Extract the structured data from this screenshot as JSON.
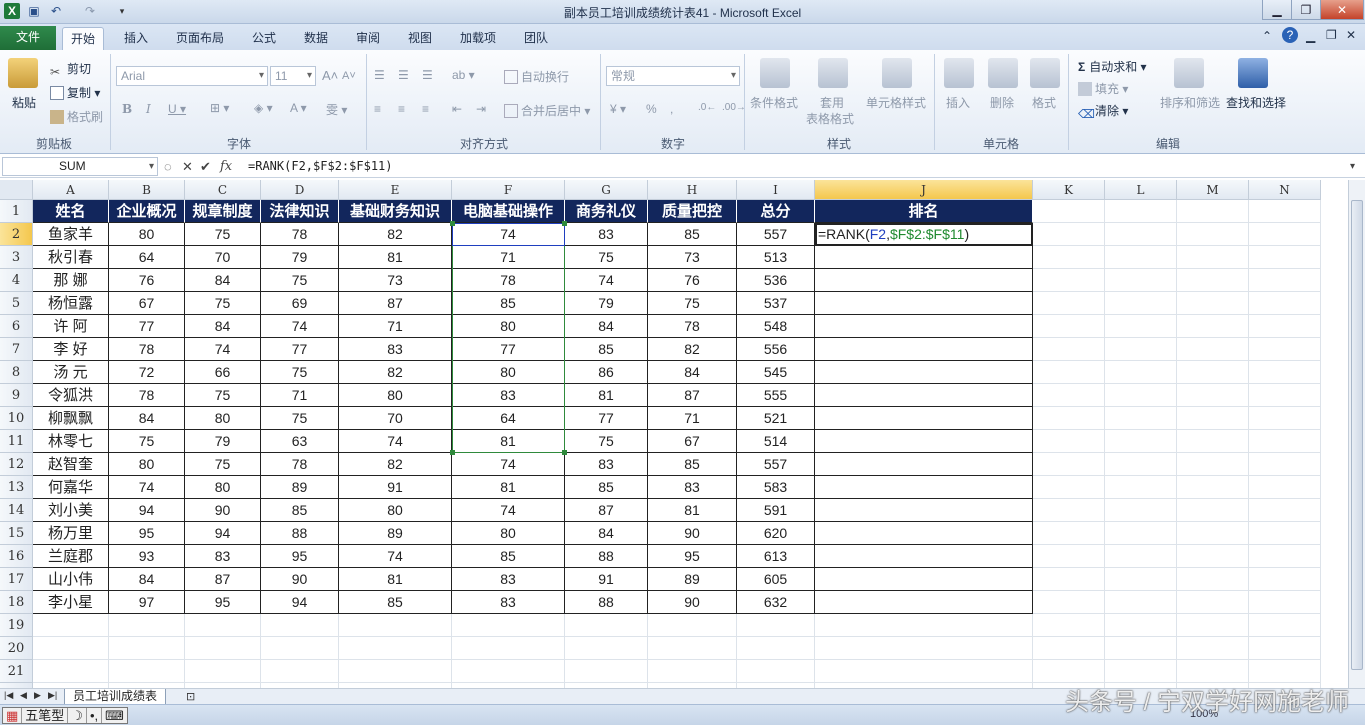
{
  "window": {
    "title": "副本员工培训成绩统计表41 - Microsoft Excel"
  },
  "tabs": [
    "文件",
    "开始",
    "插入",
    "页面布局",
    "公式",
    "数据",
    "审阅",
    "视图",
    "加载项",
    "团队"
  ],
  "ribbon": {
    "clipboard": {
      "paste": "粘贴",
      "cut": "剪切",
      "copy": "复制",
      "format_painter": "格式刷",
      "label": "剪贴板"
    },
    "font": {
      "name": "Arial",
      "size": "11",
      "label": "字体"
    },
    "alignment": {
      "wrap": "自动换行",
      "merge": "合并后居中",
      "label": "对齐方式"
    },
    "number": {
      "format": "常规",
      "label": "数字"
    },
    "styles": {
      "cond": "条件格式",
      "table_a": "套用",
      "table_b": "表格格式",
      "cell_styles": "单元格样式",
      "label": "样式"
    },
    "cells": {
      "insert": "插入",
      "delete": "删除",
      "format": "格式",
      "label": "单元格"
    },
    "editing": {
      "autosum": "自动求和",
      "fill": "填充",
      "clear": "清除",
      "sort": "排序和筛选",
      "find": "查找和选择",
      "label": "编辑"
    }
  },
  "formula_bar": {
    "name_box": "SUM",
    "formula": "=RANK(F2,$F$2:$F$11)"
  },
  "columns": [
    "A",
    "B",
    "C",
    "D",
    "E",
    "F",
    "G",
    "H",
    "I",
    "J",
    "K",
    "L",
    "M",
    "N"
  ],
  "headers": [
    "姓名",
    "企业概况",
    "规章制度",
    "法律知识",
    "基础财务知识",
    "电脑基础操作",
    "商务礼仪",
    "质量把控",
    "总分",
    "排名"
  ],
  "rows": [
    [
      "鱼家羊",
      "80",
      "75",
      "78",
      "82",
      "74",
      "83",
      "85",
      "557"
    ],
    [
      "秋引春",
      "64",
      "70",
      "79",
      "81",
      "71",
      "75",
      "73",
      "513"
    ],
    [
      "那  娜",
      "76",
      "84",
      "75",
      "73",
      "78",
      "74",
      "76",
      "536"
    ],
    [
      "杨恒露",
      "67",
      "75",
      "69",
      "87",
      "85",
      "79",
      "75",
      "537"
    ],
    [
      "许  阿",
      "77",
      "84",
      "74",
      "71",
      "80",
      "84",
      "78",
      "548"
    ],
    [
      "李  好",
      "78",
      "74",
      "77",
      "83",
      "77",
      "85",
      "82",
      "556"
    ],
    [
      "汤  元",
      "72",
      "66",
      "75",
      "82",
      "80",
      "86",
      "84",
      "545"
    ],
    [
      "令狐洪",
      "78",
      "75",
      "71",
      "80",
      "83",
      "81",
      "87",
      "555"
    ],
    [
      "柳飘飘",
      "84",
      "80",
      "75",
      "70",
      "64",
      "77",
      "71",
      "521"
    ],
    [
      "林零七",
      "75",
      "79",
      "63",
      "74",
      "81",
      "75",
      "67",
      "514"
    ],
    [
      "赵智奎",
      "80",
      "75",
      "78",
      "82",
      "74",
      "83",
      "85",
      "557"
    ],
    [
      "何嘉华",
      "74",
      "80",
      "89",
      "91",
      "81",
      "85",
      "83",
      "583"
    ],
    [
      "刘小美",
      "94",
      "90",
      "85",
      "80",
      "74",
      "87",
      "81",
      "591"
    ],
    [
      "杨万里",
      "95",
      "94",
      "88",
      "89",
      "80",
      "84",
      "90",
      "620"
    ],
    [
      "兰庭郡",
      "93",
      "83",
      "95",
      "74",
      "85",
      "88",
      "95",
      "613"
    ],
    [
      "山小伟",
      "84",
      "87",
      "90",
      "81",
      "83",
      "91",
      "89",
      "605"
    ],
    [
      "李小星",
      "97",
      "95",
      "94",
      "85",
      "83",
      "88",
      "90",
      "632"
    ]
  ],
  "row_numbers": [
    "1",
    "2",
    "3",
    "4",
    "5",
    "6",
    "7",
    "8",
    "9",
    "10",
    "11",
    "12",
    "13",
    "14",
    "15",
    "16",
    "17",
    "18",
    "19",
    "20",
    "21",
    "22"
  ],
  "edit_cell": {
    "prefix": "=RANK(",
    "ref1": "F2",
    "comma": ",",
    "ref2": "$F$2:$F$11",
    "suffix": ")"
  },
  "sheet_tab": "员工培训成绩表",
  "ime": {
    "mode": "五笔型",
    "moon": "☽",
    "dots": "•,",
    "kbd": "⌨"
  },
  "status": {
    "zoom": "100%"
  },
  "watermark": "头条号 / 宁双学好网施老师"
}
